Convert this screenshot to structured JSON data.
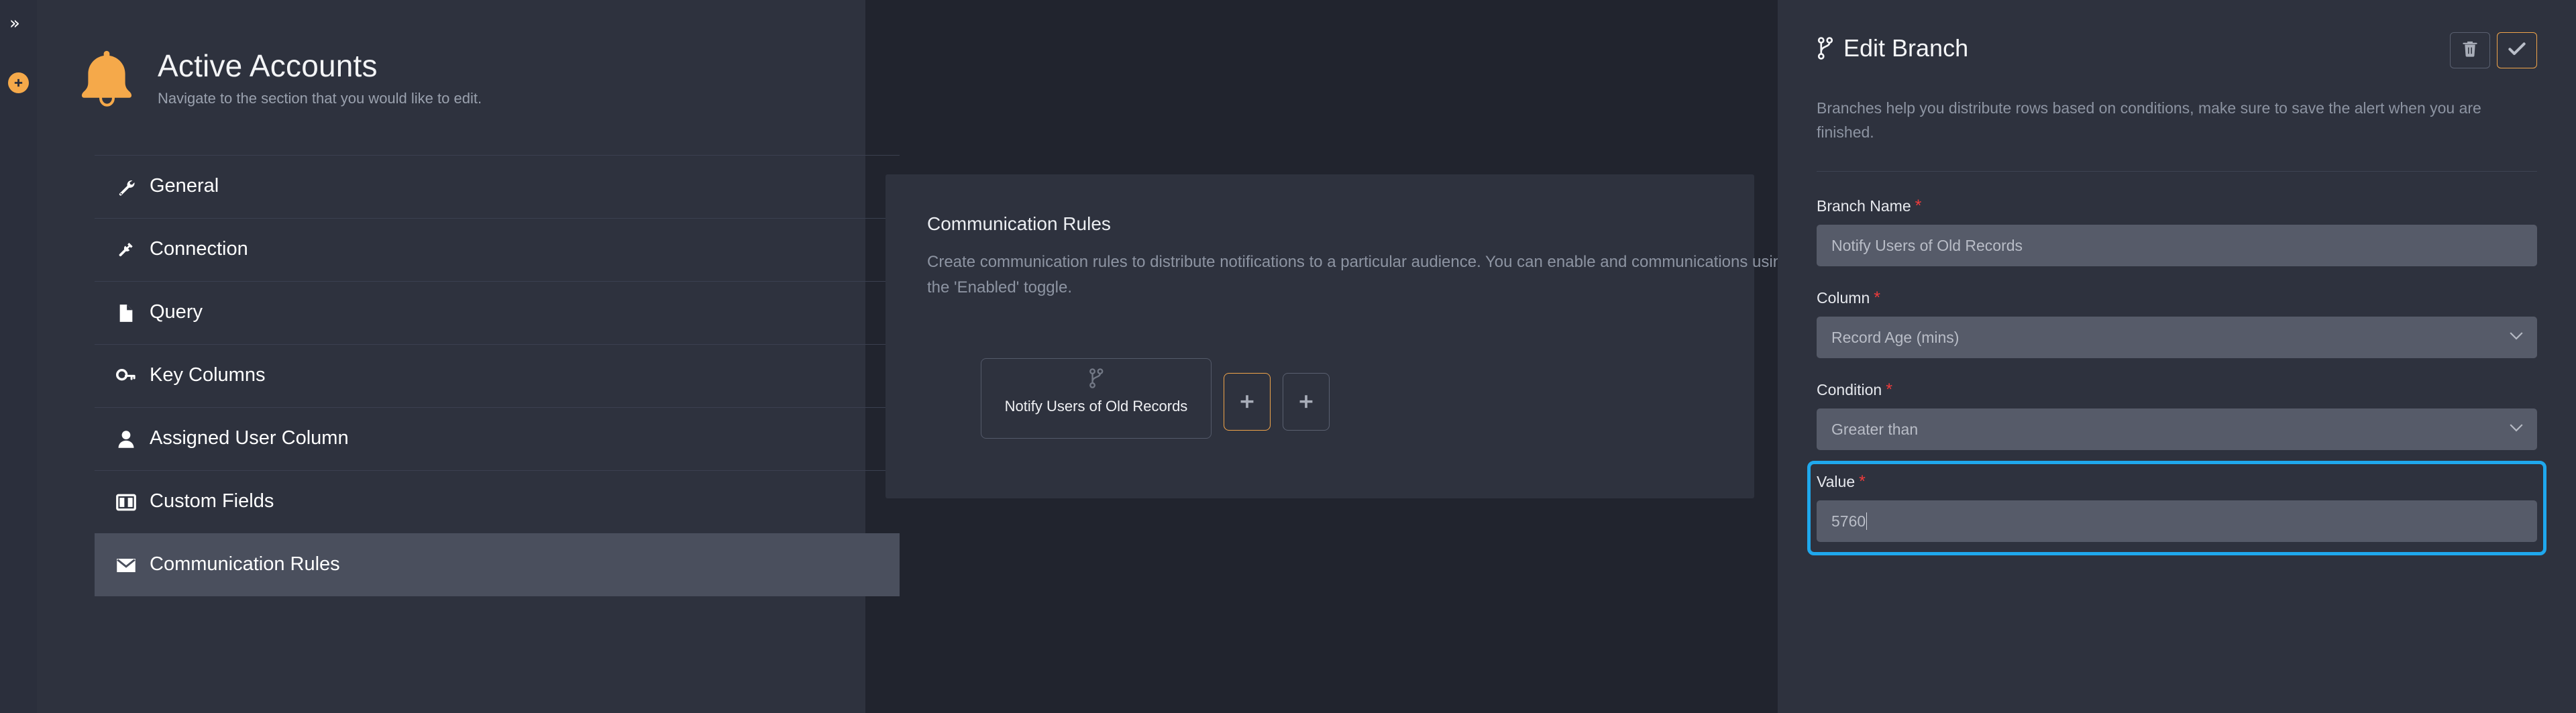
{
  "rail": {
    "expand_icon": "chevron-double-right-icon",
    "add_icon": "plus-circle-icon"
  },
  "left_panel": {
    "logo_icon": "bell-icon",
    "title": "Active Accounts",
    "subtitle": "Navigate to the section that you would like to edit.",
    "nav_items": [
      {
        "label": "General",
        "icon": "wrench-icon",
        "active": false
      },
      {
        "label": "Connection",
        "icon": "plug-icon",
        "active": false
      },
      {
        "label": "Query",
        "icon": "file-icon",
        "active": false
      },
      {
        "label": "Key Columns",
        "icon": "key-icon",
        "active": false
      },
      {
        "label": "Assigned User Column",
        "icon": "user-icon",
        "active": false
      },
      {
        "label": "Custom Fields",
        "icon": "columns-icon",
        "active": false
      },
      {
        "label": "Communication Rules",
        "icon": "envelope-icon",
        "active": true
      }
    ]
  },
  "center_panel": {
    "title": "Communication Rules",
    "description": "Create communication rules to distribute notifications to a particular audience. You can enable and communications using the 'Enabled' toggle.",
    "branch_card": {
      "icon": "branch-icon",
      "label": "Notify Users of Old Records"
    },
    "add_branch_button": {
      "icon": "plus-icon",
      "label": "+"
    },
    "add_rule_button": {
      "icon": "plus-icon",
      "label": "+"
    }
  },
  "right_panel": {
    "title": "Edit Branch",
    "title_icon": "branch-icon",
    "delete_button": {
      "icon": "trash-icon"
    },
    "confirm_button": {
      "icon": "check-icon"
    },
    "description": "Branches help you distribute rows based on conditions, make sure to save the alert when you are finished.",
    "required_marker": "*",
    "fields": [
      {
        "label": "Branch Name",
        "required": true,
        "type": "text",
        "value": "Notify Users of Old Records",
        "placeholder": "Notify Users of Old Records",
        "focused": false
      },
      {
        "label": "Column",
        "required": true,
        "type": "select",
        "value": "Record Age (mins)",
        "placeholder": "Record Age (mins)",
        "focused": false
      },
      {
        "label": "Condition",
        "required": true,
        "type": "select",
        "value": "Greater than",
        "placeholder": "Greater than",
        "focused": false
      },
      {
        "label": "Value",
        "required": true,
        "type": "text",
        "value": "5760",
        "placeholder": "5760",
        "focused": true
      }
    ]
  },
  "colors": {
    "page_background": "#21242e",
    "panel_background": "#2e323e",
    "rail_background": "#2b2f3c",
    "accent_orange": "#f0a44a",
    "focus_blue": "#1fa8ed",
    "required_red": "#ef3b3b",
    "input_background": "#565b69",
    "nav_active_background": "#4a4f5d"
  }
}
